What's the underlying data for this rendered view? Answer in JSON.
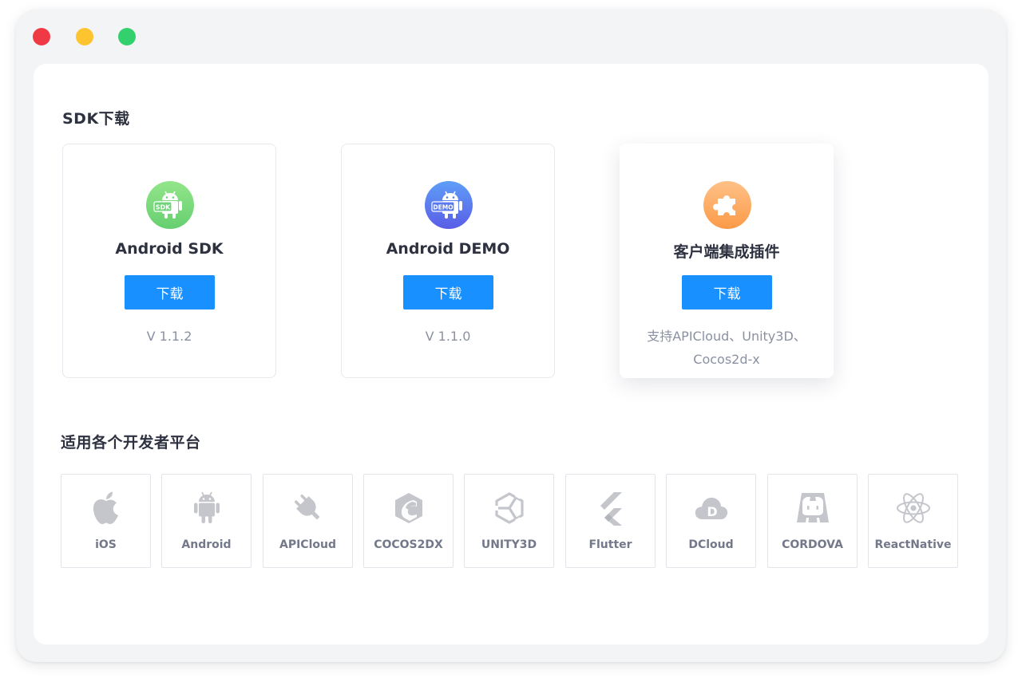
{
  "sdk_section": {
    "title": "SDK下载",
    "cards": [
      {
        "name": "Android SDK",
        "button": "下载",
        "note": "V 1.1.2",
        "logo_icon": "android-sdk-icon"
      },
      {
        "name": "Android DEMO",
        "button": "下载",
        "note": "V 1.1.0",
        "logo_icon": "android-demo-icon"
      },
      {
        "name": "客户端集成插件",
        "button": "下载",
        "note": "支持APICloud、Unity3D、Cocos2d-x",
        "logo_icon": "puzzle-piece-icon"
      }
    ],
    "badges": {
      "sdk": "SDK",
      "demo": "DEMO"
    }
  },
  "platform_section": {
    "title": "适用各个开发者平台",
    "platforms": [
      {
        "label": "iOS",
        "icon": "apple-icon"
      },
      {
        "label": "Android",
        "icon": "android-icon"
      },
      {
        "label": "APICloud",
        "icon": "plug-icon"
      },
      {
        "label": "COCOS2DX",
        "icon": "cocos-icon"
      },
      {
        "label": "UNITY3D",
        "icon": "unity-icon"
      },
      {
        "label": "Flutter",
        "icon": "flutter-icon"
      },
      {
        "label": "DCloud",
        "icon": "dcloud-icon"
      },
      {
        "label": "CORDOVA",
        "icon": "cordova-icon"
      },
      {
        "label": "ReactNative",
        "icon": "react-icon"
      }
    ],
    "dcloud_glyph": "D"
  },
  "colors": {
    "primary": "#1890ff",
    "traffic_red": "#ef3a46",
    "traffic_yellow": "#fdc42f",
    "traffic_green": "#33d16e",
    "platform_icon": "#c4c6cc"
  }
}
